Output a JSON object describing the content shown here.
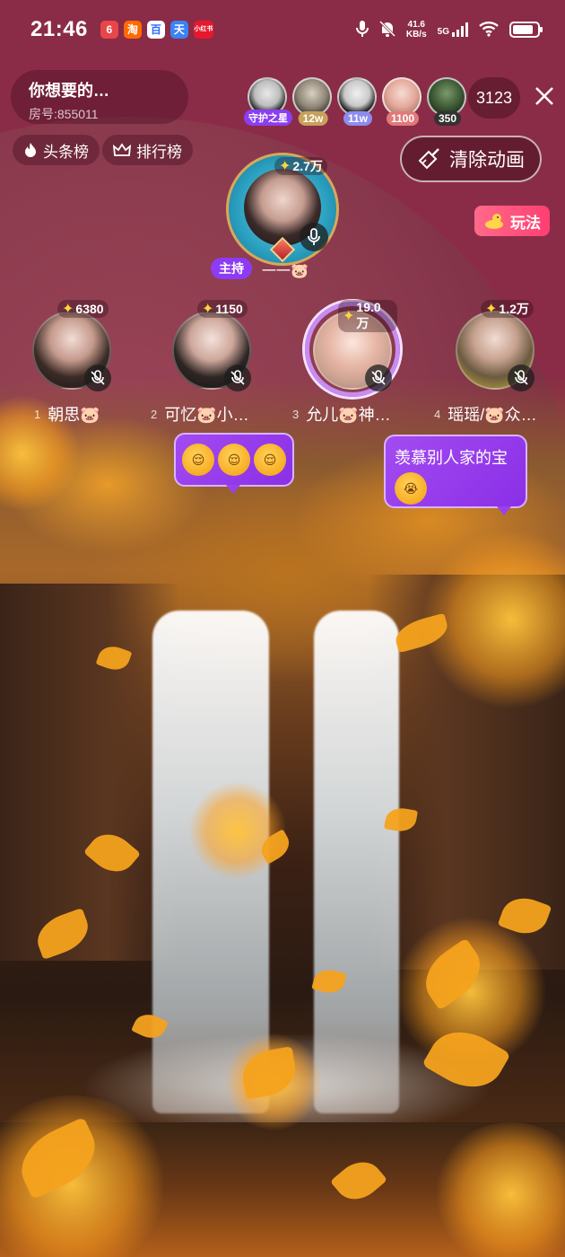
{
  "status_bar": {
    "time": "21:46",
    "apps": [
      "6",
      "淘",
      "百",
      "天",
      "小红书"
    ],
    "speed_value": "41.6",
    "speed_unit": "KB/s",
    "network": "5G"
  },
  "room": {
    "title": "你想要的…",
    "room_id": "房号:855011"
  },
  "viewers": [
    {
      "name": "guardian-viewer",
      "badge": "守护之星",
      "badge_color": "#8b3ef2"
    },
    {
      "name": "viewer-2",
      "badge": "12w",
      "badge_color": "#c7a15a"
    },
    {
      "name": "viewer-3",
      "badge": "11w",
      "badge_color": "#8c8cf0"
    },
    {
      "name": "viewer-4",
      "badge": "1100",
      "badge_color": "#e07a7a"
    },
    {
      "name": "viewer-5",
      "badge": "350",
      "badge_color": "#333333"
    }
  ],
  "online_count": "3123",
  "chips": {
    "headlines": "头条榜",
    "ranking": "排行榜"
  },
  "clear_animation": "清除动画",
  "play_button": "玩法",
  "host": {
    "score": "2.7万",
    "tag": "主持",
    "name": "一一🐷"
  },
  "seats": [
    {
      "num": "1",
      "score": "6380",
      "name": "朝思🐷"
    },
    {
      "num": "2",
      "score": "1150",
      "name": "可忆🐷小…"
    },
    {
      "num": "3",
      "score": "19.0万",
      "name": "允儿🐷神…"
    },
    {
      "num": "4",
      "score": "1.2万",
      "name": "瑶瑶/🐷众…"
    }
  ],
  "bubbles": {
    "left_emojis": [
      "😌",
      "😌",
      "😌"
    ],
    "right_text": "羡慕别人家的宝",
    "right_emoji": "😭"
  },
  "colors": {
    "top_bg": "#8a2c47",
    "bubble": "#9a40ee",
    "play_btn": "#ff3f71",
    "host_tag": "#8d3bf5"
  },
  "icons": {
    "mic": "mic-icon",
    "mic_off": "mic-off-icon",
    "close": "close-icon",
    "flame": "flame-icon",
    "crown": "crown-icon",
    "broom": "broom-icon",
    "duck": "duck-icon",
    "star": "star-icon"
  }
}
